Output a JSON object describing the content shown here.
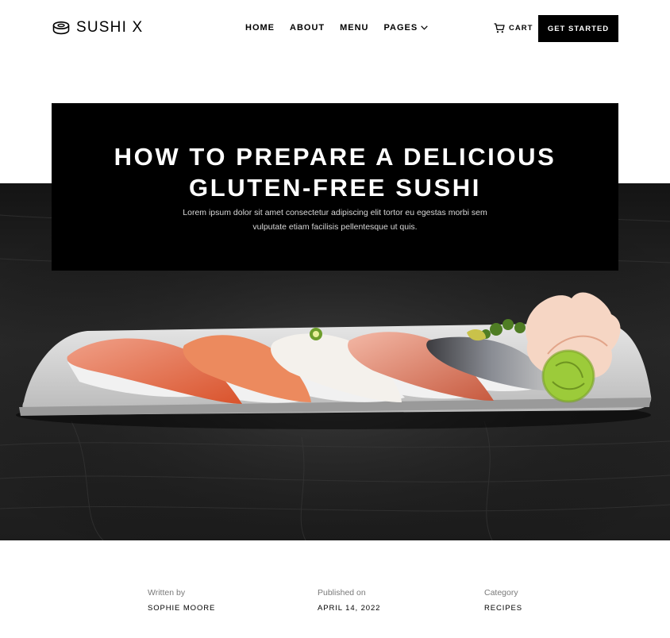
{
  "nav": {
    "brand": "SUSHI X",
    "links": [
      {
        "label": "HOME"
      },
      {
        "label": "ABOUT"
      },
      {
        "label": "MENU"
      },
      {
        "label": "PAGES"
      }
    ],
    "cart_label": "CART",
    "cta_label": "GET STARTED"
  },
  "hero": {
    "title_line1": "HOW TO PREPARE A DELICIOUS",
    "title_line2": "GLUTEN-FREE SUSHI",
    "subtitle_line1": "Lorem ipsum dolor sit amet consectetur adipiscing elit tortor eu egestas morbi sem",
    "subtitle_line2": "vulputate etiam facilisis pellentesque ut quis."
  },
  "meta": {
    "author_label": "Written by",
    "author": "SOPHIE MOORE",
    "date_label": "Published on",
    "date": "APRIL 14, 2022",
    "category_label": "Category",
    "category": "RECIPES"
  },
  "icons": {
    "logo": "sushi-roll-icon",
    "pages_dropdown": "chevron-down-icon",
    "cart": "cart-icon"
  },
  "colors": {
    "background": "#ffffff",
    "primary": "#000000",
    "hero_bg": "#1b1b1b"
  }
}
